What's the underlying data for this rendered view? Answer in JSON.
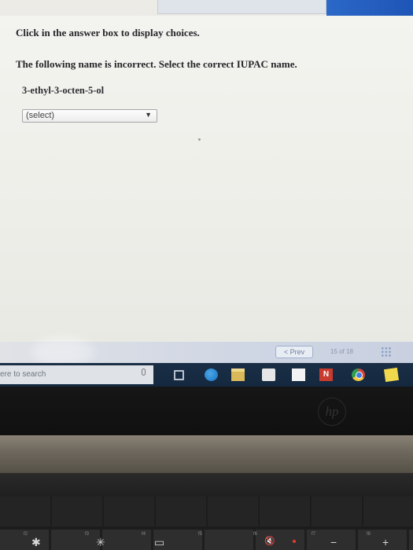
{
  "assignment": {
    "instruction": "Click in the answer box to display choices.",
    "question": "The following name is incorrect. Select the correct IUPAC name.",
    "compound_name": "3-ethyl-3-octen-5-ol",
    "answer_select": {
      "selected": "(select)"
    }
  },
  "navigation": {
    "prev_label": "< Prev",
    "page_counter": "15 of 18"
  },
  "taskbar": {
    "search_placeholder": "Type here to search",
    "visible_search_text": "ere to search",
    "onenote_letter": "N"
  },
  "laptop": {
    "logo": "hp"
  },
  "function_keys": [
    {
      "label": "f2",
      "glyph": "✱"
    },
    {
      "label": "f3",
      "glyph": "✳"
    },
    {
      "label": "f4",
      "glyph": "▭"
    },
    {
      "label": "f5",
      "glyph": ""
    },
    {
      "label": "f6",
      "glyph": "🔇"
    },
    {
      "label": "f7",
      "glyph": "−"
    },
    {
      "label": "f8",
      "glyph": "+"
    }
  ],
  "colors": {
    "taskbar": "#14283f",
    "accent_blue": "#2b68c8",
    "onenote_red": "#c93b2e"
  }
}
